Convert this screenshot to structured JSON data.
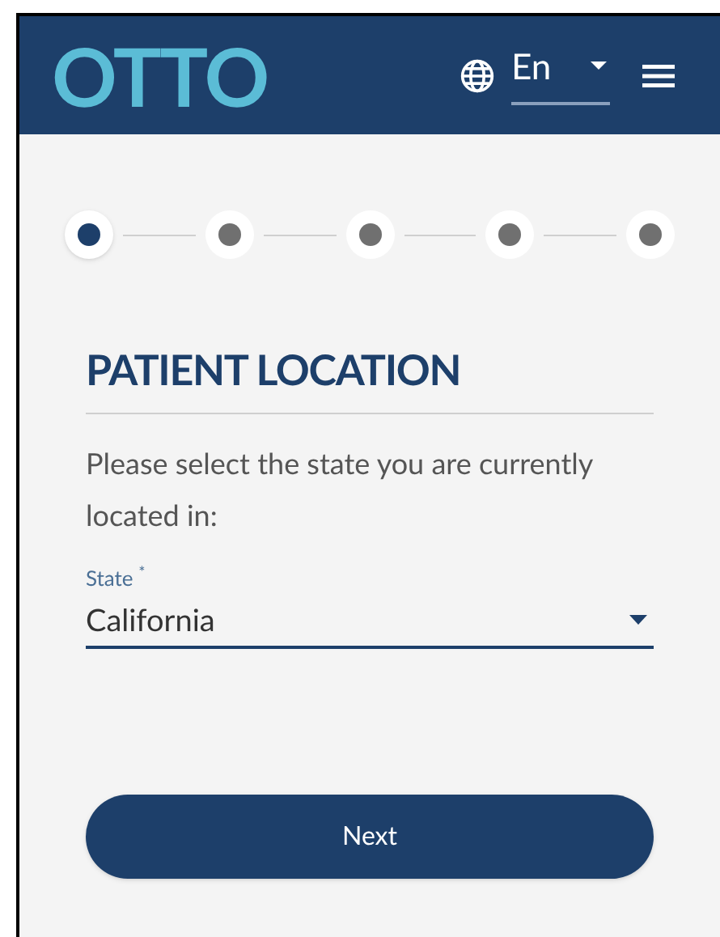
{
  "header": {
    "logo": "OTTO",
    "language": {
      "value": "En"
    }
  },
  "steps": [
    {
      "selected": true
    },
    {
      "selected": false
    },
    {
      "selected": false
    },
    {
      "selected": false
    },
    {
      "selected": false
    }
  ],
  "title": "PATIENT LOCATION",
  "instruction": "Please select the state you are currently located in:",
  "state_field": {
    "label": "State $^{*}$",
    "value": "California"
  },
  "next_button": "Next"
}
